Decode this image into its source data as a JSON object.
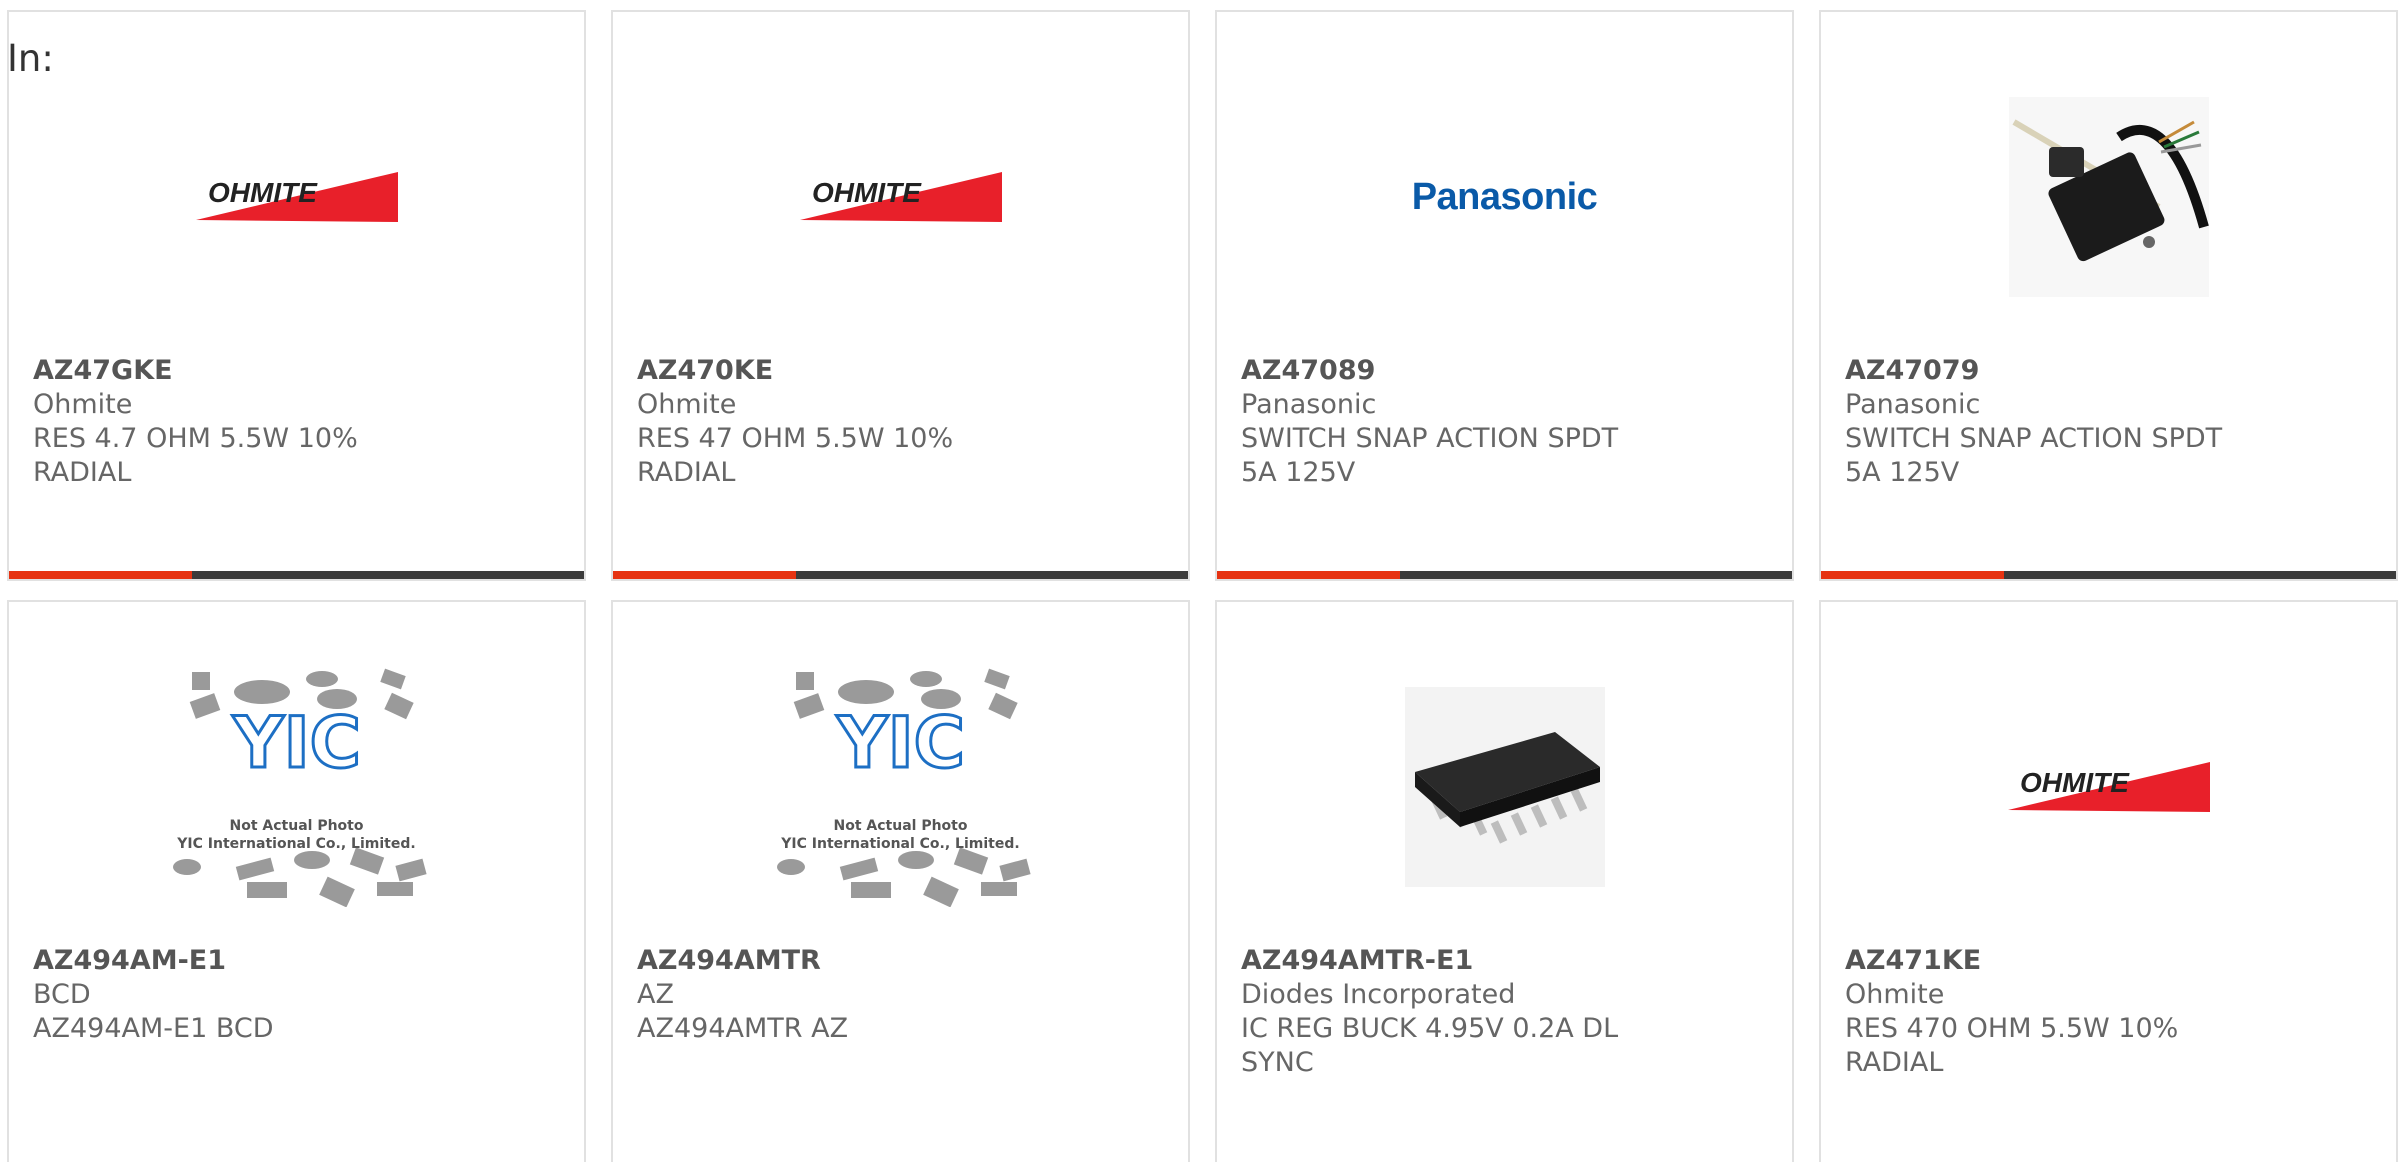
{
  "header": {
    "in_label": "In:"
  },
  "colors": {
    "accent": "#e63312",
    "bar_dark": "#3b3b3b",
    "panasonic_blue": "#0a5aa8",
    "ohmite_red": "#e8202a"
  },
  "products": [
    {
      "part": "AZ47GKE",
      "manufacturer": "Ohmite",
      "description": "RES 4.7 OHM 5.5W 10% RADIAL",
      "image": "ohmite-logo"
    },
    {
      "part": "AZ470KE",
      "manufacturer": "Ohmite",
      "description": "RES 47 OHM 5.5W 10% RADIAL",
      "image": "ohmite-logo"
    },
    {
      "part": "AZ47089",
      "manufacturer": "Panasonic",
      "description": "SWITCH SNAP ACTION SPDT 5A 125V",
      "image": "panasonic-logo"
    },
    {
      "part": "AZ47079",
      "manufacturer": "Panasonic",
      "description": "SWITCH SNAP ACTION SPDT 5A 125V",
      "image": "switch-photo"
    },
    {
      "part": "AZ494AM-E1",
      "manufacturer": "BCD",
      "description": "AZ494AM-E1 BCD",
      "image": "yic-placeholder"
    },
    {
      "part": "AZ494AMTR",
      "manufacturer": "AZ",
      "description": "AZ494AMTR AZ",
      "image": "yic-placeholder"
    },
    {
      "part": "AZ494AMTR-E1",
      "manufacturer": "Diodes Incorporated",
      "description": "IC REG BUCK 4.95V 0.2A DL SYNC",
      "image": "ic-photo"
    },
    {
      "part": "AZ471KE",
      "manufacturer": "Ohmite",
      "description": "RES 470 OHM 5.5W 10% RADIAL",
      "image": "ohmite-logo"
    }
  ],
  "logos": {
    "ohmite": "OHMITE",
    "panasonic": "Panasonic",
    "yic_line1": "Not Actual Photo",
    "yic_line2": "YIC International Co., Limited.",
    "yic_mark": "YIC"
  }
}
